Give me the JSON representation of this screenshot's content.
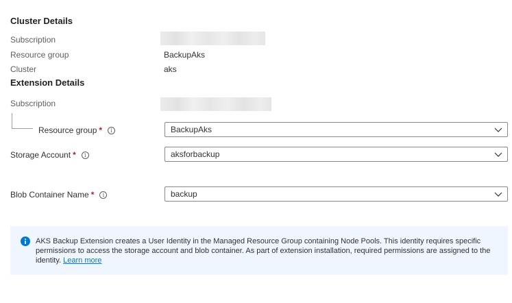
{
  "cluster_details": {
    "title": "Cluster Details",
    "subscription_label": "Subscription",
    "resource_group_label": "Resource group",
    "resource_group_value": "BackupAks",
    "cluster_label": "Cluster",
    "cluster_value": "aks"
  },
  "extension_details": {
    "title": "Extension Details",
    "subscription_label": "Subscription",
    "resource_group": {
      "label": "Resource group",
      "required_mark": "*",
      "value": "BackupAks"
    },
    "storage_account": {
      "label": "Storage Account",
      "required_mark": "*",
      "value": "aksforbackup"
    },
    "blob_container": {
      "label": "Blob Container Name",
      "required_mark": "*",
      "value": "backup"
    }
  },
  "info_banner": {
    "icon": "info-icon",
    "text": "AKS Backup Extension creates a User Identity in the Managed Resource Group containing Node Pools. This identity requires specific permissions to access the storage account and blob container. As part of extension installation, required permissions are assigned to the identity.",
    "link_text": "Learn more"
  },
  "colors": {
    "accent": "#0078d4",
    "required": "#a4262c",
    "banner_background": "#f0f6ff"
  }
}
